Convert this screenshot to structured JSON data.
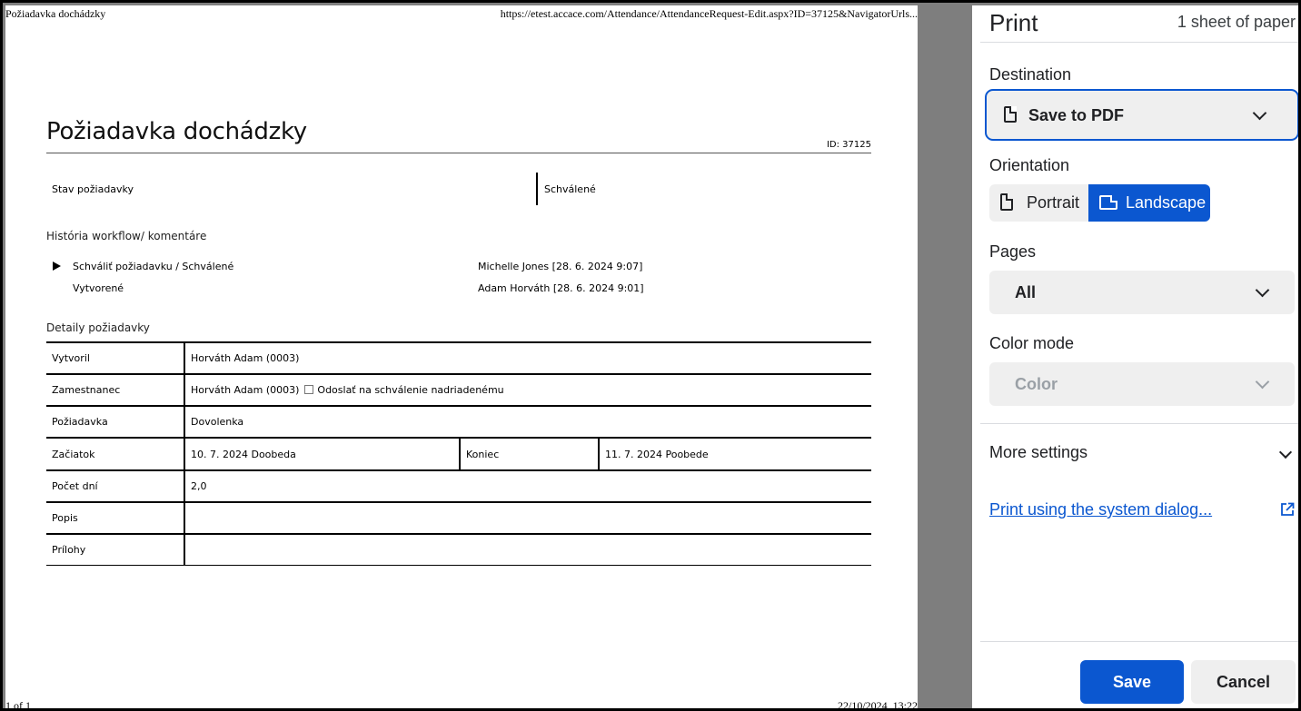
{
  "preview": {
    "header_left": "Požiadavka dochádzky",
    "header_right": "https://etest.accace.com/Attendance/AttendanceRequest-Edit.aspx?ID=37125&NavigatorUrls...",
    "footer_left": "1 of 1",
    "footer_right": "22/10/2024, 13:22",
    "document": {
      "title": "Požiadavka dochádzky",
      "id_text": "ID: 37125",
      "status_label": "Stav požiadavky",
      "status_value": "Schválené",
      "workflow_heading": "História workflow/ komentáre",
      "workflow": [
        {
          "text": "Schváliť požiadavku / Schválené",
          "who": "Michelle Jones [28. 6. 2024 9:07]"
        },
        {
          "text": "Vytvorené",
          "who": "Adam Horváth [28. 6. 2024 9:01]"
        }
      ],
      "details_heading": "Detaily požiadavky",
      "details": {
        "created_by_label": "Vytvoril",
        "created_by_value": "Horváth Adam (0003)",
        "employee_label": "Zamestnanec",
        "employee_value": "Horváth Adam (0003)",
        "send_checkbox_label": "Odoslať na schválenie nadriadenému",
        "request_label": "Požiadavka",
        "request_value": "Dovolenka",
        "start_label": "Začiatok",
        "start_value": "10. 7. 2024 Doobeda",
        "end_label": "Koniec",
        "end_value": "11. 7. 2024 Poobede",
        "days_label": "Počet dní",
        "days_value": "2,0",
        "description_label": "Popis",
        "description_value": "",
        "attachments_label": "Prílohy",
        "attachments_value": ""
      }
    }
  },
  "panel": {
    "title": "Print",
    "sheets": "1 sheet of paper",
    "destination_label": "Destination",
    "destination_value": "Save to PDF",
    "orientation_label": "Orientation",
    "portrait_label": "Portrait",
    "landscape_label": "Landscape",
    "orientation_selected": "Landscape",
    "pages_label": "Pages",
    "pages_value": "All",
    "color_mode_label": "Color mode",
    "color_mode_value": "Color",
    "more_settings_label": "More settings",
    "system_dialog_link": "Print using the system dialog...",
    "save_button": "Save",
    "cancel_button": "Cancel"
  },
  "colors": {
    "accent": "#0b57d0",
    "select_bg": "#efefef",
    "gutter": "#7e7e7e"
  },
  "icons": [
    "document-icon",
    "portrait-icon",
    "landscape-icon",
    "chevron-down-icon",
    "external-link-icon",
    "expand-triangle-icon"
  ]
}
